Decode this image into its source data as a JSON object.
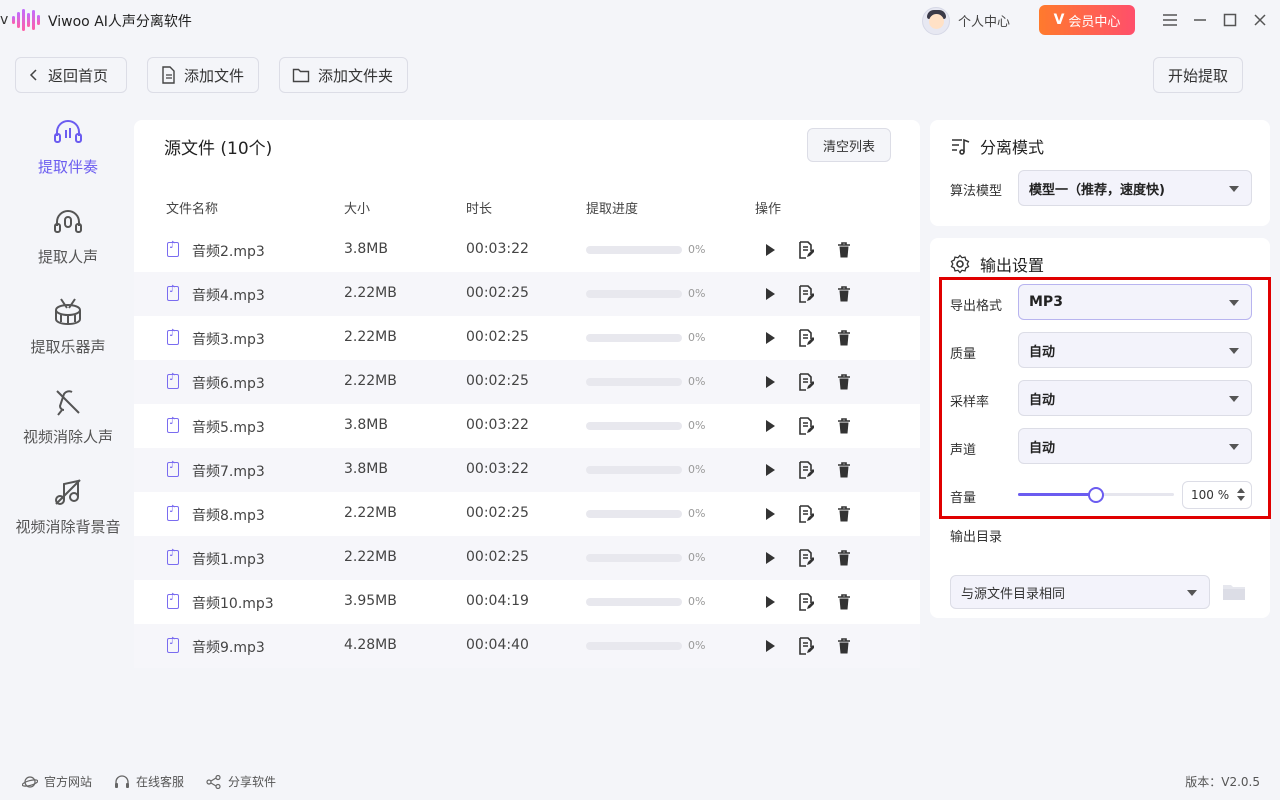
{
  "app": {
    "title": "Viwoo AI人声分离软件"
  },
  "header": {
    "personal_center": "个人中心",
    "vip_center": "会员中心"
  },
  "toolbar": {
    "back": "返回首页",
    "add_file": "添加文件",
    "add_folder": "添加文件夹",
    "start": "开始提取"
  },
  "nav": [
    {
      "label": "提取伴奏",
      "icon": "headphone-music-icon",
      "active": true
    },
    {
      "label": "提取人声",
      "icon": "headphone-mic-icon"
    },
    {
      "label": "提取乐器声",
      "icon": "drum-icon"
    },
    {
      "label": "视频消除人声",
      "icon": "mic-off-icon"
    },
    {
      "label": "视频消除背景音",
      "icon": "music-off-icon"
    }
  ],
  "files": {
    "title": "源文件 (10个)",
    "clear": "清空列表",
    "columns": {
      "name": "文件名称",
      "size": "大小",
      "duration": "时长",
      "progress": "提取进度",
      "actions": "操作"
    },
    "rows": [
      {
        "name": "音频2.mp3",
        "size": "3.8MB",
        "duration": "00:03:22",
        "progress": "0%"
      },
      {
        "name": "音频4.mp3",
        "size": "2.22MB",
        "duration": "00:02:25",
        "progress": "0%"
      },
      {
        "name": "音频3.mp3",
        "size": "2.22MB",
        "duration": "00:02:25",
        "progress": "0%"
      },
      {
        "name": "音频6.mp3",
        "size": "2.22MB",
        "duration": "00:02:25",
        "progress": "0%"
      },
      {
        "name": "音频5.mp3",
        "size": "3.8MB",
        "duration": "00:03:22",
        "progress": "0%"
      },
      {
        "name": "音频7.mp3",
        "size": "3.8MB",
        "duration": "00:03:22",
        "progress": "0%"
      },
      {
        "name": "音频8.mp3",
        "size": "2.22MB",
        "duration": "00:02:25",
        "progress": "0%"
      },
      {
        "name": "音频1.mp3",
        "size": "2.22MB",
        "duration": "00:02:25",
        "progress": "0%"
      },
      {
        "name": "音频10.mp3",
        "size": "3.95MB",
        "duration": "00:04:19",
        "progress": "0%"
      },
      {
        "name": "音频9.mp3",
        "size": "4.28MB",
        "duration": "00:04:40",
        "progress": "0%"
      }
    ]
  },
  "mode": {
    "title": "分离模式",
    "algo_label": "算法模型",
    "algo_value": "模型一（推荐，速度快)"
  },
  "output": {
    "title": "输出设置",
    "format_label": "导出格式",
    "format_value": "MP3",
    "quality_label": "质量",
    "quality_value": "自动",
    "sample_label": "采样率",
    "sample_value": "自动",
    "channel_label": "声道",
    "channel_value": "自动",
    "volume_label": "音量",
    "volume_value": "100 %",
    "volume_fraction": 0.5,
    "dir_label": "输出目录",
    "dir_value": "与源文件目录相同"
  },
  "footer": {
    "website": "官方网站",
    "support": "在线客服",
    "share": "分享软件",
    "version": "版本：V2.0.5"
  },
  "colors": {
    "accent": "#6b5cf0",
    "vip_start": "#ff7a2d",
    "vip_end": "#ff4f6b",
    "highlight": "#e00000"
  }
}
